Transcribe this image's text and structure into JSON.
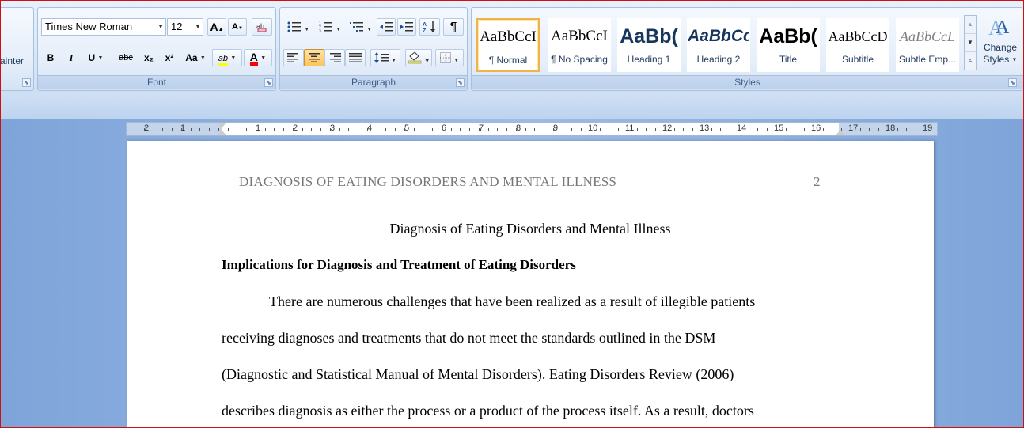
{
  "ribbon": {
    "clipboard": {
      "format_painter_label": "ainter"
    },
    "font": {
      "label": "Font",
      "font_name": "Times New Roman",
      "font_size": "12",
      "grow_label": "A",
      "shrink_label": "A",
      "bold_label": "B",
      "italic_label": "I",
      "underline_label": "U",
      "strike_label": "abc",
      "subscript_label": "x₂",
      "superscript_label": "x²",
      "case_label": "Aa",
      "highlight_label": "ab",
      "font_color_label": "A",
      "highlight_color": "#ffff00",
      "font_color": "#ff0000"
    },
    "paragraph": {
      "label": "Paragraph"
    },
    "styles": {
      "label": "Styles",
      "items": [
        {
          "sample": "AaBbCcI",
          "name": "¶ Normal"
        },
        {
          "sample": "AaBbCcI",
          "name": "¶ No Spacing"
        },
        {
          "sample": "AaBb(",
          "name": "Heading 1"
        },
        {
          "sample": "AaBbCc",
          "name": "Heading 2"
        },
        {
          "sample": "AaBb(",
          "name": "Title"
        },
        {
          "sample": "AaBbCcD",
          "name": "Subtitle"
        },
        {
          "sample": "AaBbCcL",
          "name": "Subtle Emp..."
        }
      ],
      "change_styles_line1": "Change",
      "change_styles_line2": "Styles"
    }
  },
  "document": {
    "running_head": "DIAGNOSIS  OF EATING DISORDERS  AND MENTAL ILLNESS",
    "page_number": "2",
    "title": "Diagnosis of Eating Disorders and Mental Illness",
    "heading": "Implications  for Diagnosis  and  Treatment  of Eating  Disorders",
    "lines": [
      "There are numerous challenges that have been realized as a result of illegible patients",
      "receiving diagnoses and treatments that do not meet the standards outlined in the DSM",
      "(Diagnostic and Statistical Manual of Mental Disorders). Eating Disorders Review (2006)",
      "describes diagnosis as either the process or a product of the process itself. As a result, doctors"
    ]
  },
  "ruler": {
    "labels": [
      "2",
      "1",
      "1",
      "2",
      "3",
      "4",
      "5",
      "6",
      "7",
      "8",
      "9",
      "10",
      "11",
      "12",
      "13",
      "14",
      "15",
      "16",
      "17",
      "18",
      "19"
    ]
  }
}
